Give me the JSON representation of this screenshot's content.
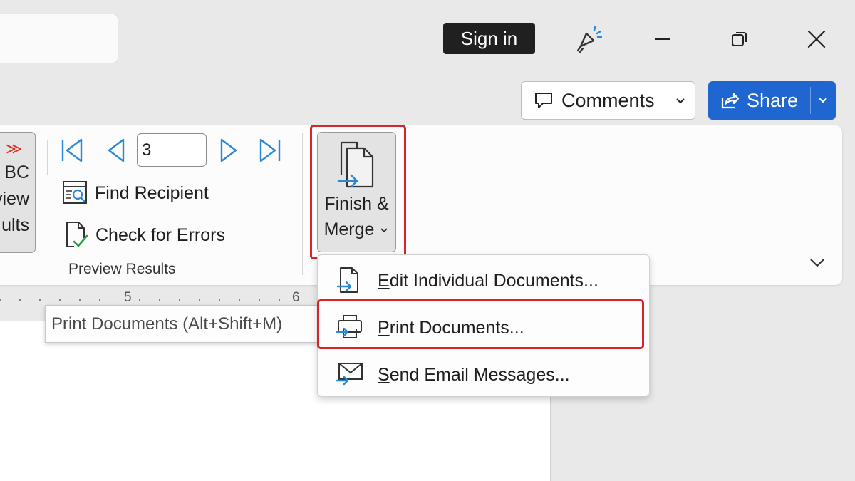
{
  "titlebar": {
    "sign_in": "Sign in"
  },
  "toolbar": {
    "comments": "Comments",
    "share": "Share"
  },
  "ribbon": {
    "preview_results_button": {
      "line1": "BC",
      "line2": "view",
      "line3": "ults"
    },
    "record_number": "3",
    "find_recipient": "Find Recipient",
    "check_for_errors": "Check for Errors",
    "group_label": "Preview Results",
    "finish_merge": {
      "line1": "Finish &",
      "line2": "Merge"
    }
  },
  "ruler": {
    "mark_5": "5",
    "mark_6": "6"
  },
  "tooltip": {
    "text": "Print Documents (Alt+Shift+M)"
  },
  "menu": {
    "items": [
      {
        "accel": "E",
        "rest": "dit Individual Documents..."
      },
      {
        "accel": "P",
        "rest": "rint Documents..."
      },
      {
        "accel": "S",
        "rest": "end Email Messages..."
      }
    ]
  },
  "colors": {
    "accent": "#1f66d1",
    "highlight": "#d8232a",
    "icon_blue": "#2b88d8"
  }
}
